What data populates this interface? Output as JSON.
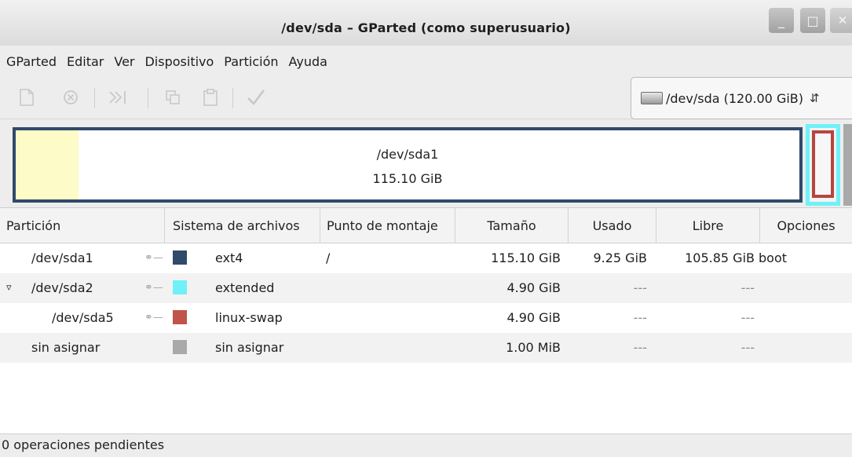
{
  "window": {
    "title": "/dev/sda – GParted (como superusuario)",
    "controls": {
      "minimize": "_",
      "maximize": "□",
      "close": "✕"
    }
  },
  "menu": [
    "GParted",
    "Editar",
    "Ver",
    "Dispositivo",
    "Partición",
    "Ayuda"
  ],
  "toolbar": {
    "icons": [
      "new-icon",
      "delete-icon",
      "resize-move-icon",
      "copy-icon",
      "paste-icon",
      "apply-icon"
    ],
    "device_selector": {
      "label": "/dev/sda  (120.00 GiB)",
      "icon": "drive-icon"
    }
  },
  "partition_map": {
    "main": {
      "name": "/dev/sda1",
      "size": "115.10 GiB",
      "used_fraction": 0.08
    },
    "colors": {
      "ext4": "#304a6a",
      "extended": "#6ff1f7",
      "linux_swap": "#b5463e",
      "unallocated": "#a9a9a9",
      "used": "#fdfbc8"
    }
  },
  "table": {
    "columns": [
      "Partición",
      "Sistema de archivos",
      "Punto de montaje",
      "Tamaño",
      "Usado",
      "Libre",
      "Opciones"
    ],
    "rows": [
      {
        "partition": "/dev/sda1",
        "fs": "ext4",
        "mount": "/",
        "size": "115.10 GiB",
        "used": "9.25 GiB",
        "free": "105.85 GiB",
        "flags": "boot",
        "color": "#304a6a",
        "key": true
      },
      {
        "partition": "/dev/sda2",
        "fs": "extended",
        "mount": "",
        "size": "4.90 GiB",
        "used": "---",
        "free": "---",
        "flags": "",
        "color": "#6ff1f7",
        "key": true,
        "expander": "▿"
      },
      {
        "partition": "/dev/sda5",
        "fs": "linux-swap",
        "mount": "",
        "size": "4.90 GiB",
        "used": "---",
        "free": "---",
        "flags": "",
        "color": "#c0534a",
        "key": true
      },
      {
        "partition": "sin asignar",
        "fs": "sin asignar",
        "mount": "",
        "size": "1.00 MiB",
        "used": "---",
        "free": "---",
        "flags": "",
        "color": "#a9a9a9",
        "key": false
      }
    ]
  },
  "status": "0 operaciones pendientes"
}
